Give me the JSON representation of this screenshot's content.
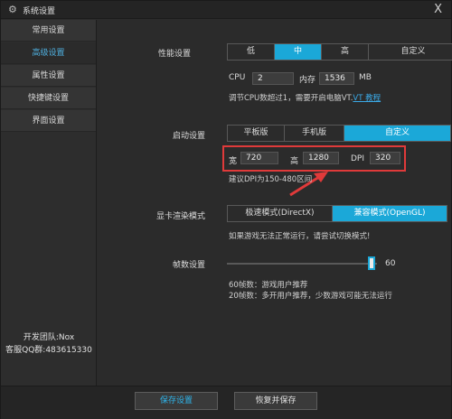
{
  "window": {
    "title": "系统设置",
    "close": "X"
  },
  "sidebar": {
    "items": [
      {
        "label": "常用设置"
      },
      {
        "label": "高级设置"
      },
      {
        "label": "属性设置"
      },
      {
        "label": "快捷键设置"
      },
      {
        "label": "界面设置"
      }
    ],
    "active_index": 1,
    "dev_team": "开发团队:Nox",
    "support_qq": "客服QQ群:483615330"
  },
  "performance": {
    "label": "性能设置",
    "options": [
      "低",
      "中",
      "高",
      "自定义"
    ],
    "selected": "中",
    "cpu_label": "CPU",
    "cpu_value": "2",
    "memory_label": "内存",
    "memory_value": "1536",
    "memory_unit": "MB",
    "hint": "调节CPU数超过1，需要开启电脑VT.",
    "hint_link": "VT 教程"
  },
  "startup": {
    "label": "启动设置",
    "options": [
      "平板版",
      "手机版",
      "自定义"
    ],
    "selected": "自定义",
    "width_label": "宽",
    "width_value": "720",
    "height_label": "高",
    "height_value": "1280",
    "dpi_label": "DPI",
    "dpi_value": "320",
    "dpi_hint": "建议DPI为150-480区间"
  },
  "render": {
    "label": "显卡渲染模式",
    "options": [
      "极速模式(DirectX)",
      "兼容模式(OpenGL)"
    ],
    "selected": "兼容模式(OpenGL)",
    "hint": "如果游戏无法正常运行，请尝试切换模式!"
  },
  "fps": {
    "label": "帧数设置",
    "value": "60",
    "value_number": 60,
    "hint1": "60帧数：游戏用户推荐",
    "hint2": "20帧数：多开用户推荐，少数游戏可能无法运行"
  },
  "footer": {
    "save": "保存设置",
    "reset": "恢复并保存"
  },
  "colors": {
    "accent": "#1ba8d8",
    "highlight_box": "#e03a3a",
    "background": "#2b2b2b"
  }
}
